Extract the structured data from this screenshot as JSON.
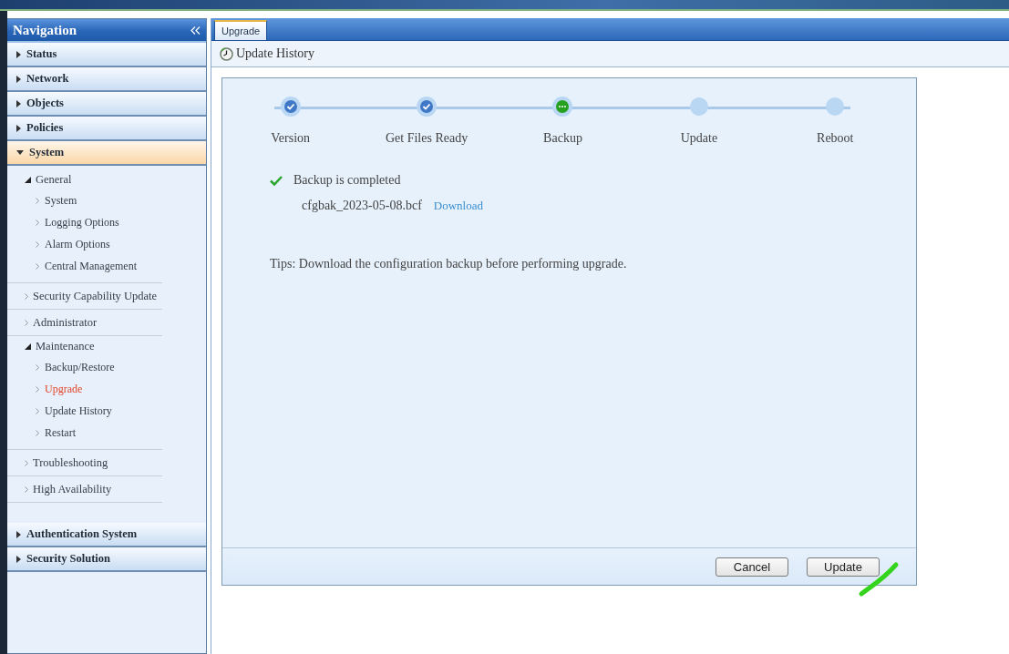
{
  "sidebar": {
    "title": "Navigation",
    "sections": [
      {
        "label": "Status",
        "expanded": false
      },
      {
        "label": "Network",
        "expanded": false
      },
      {
        "label": "Objects",
        "expanded": false
      },
      {
        "label": "Policies",
        "expanded": false
      },
      {
        "label": "System",
        "expanded": true,
        "children": [
          {
            "label": "General",
            "expanded": true,
            "children": [
              {
                "label": "System",
                "selected": false
              },
              {
                "label": "Logging Options",
                "selected": false
              },
              {
                "label": "Alarm Options",
                "selected": false
              },
              {
                "label": "Central Management",
                "selected": false
              }
            ]
          },
          {
            "label": "Security Capability Update",
            "expanded": false
          },
          {
            "label": "Administrator",
            "expanded": false
          },
          {
            "label": "Maintenance",
            "expanded": true,
            "children": [
              {
                "label": "Backup/Restore",
                "selected": false
              },
              {
                "label": "Upgrade",
                "selected": true
              },
              {
                "label": "Update History",
                "selected": false
              },
              {
                "label": "Restart",
                "selected": false
              }
            ]
          },
          {
            "label": "Troubleshooting",
            "expanded": false
          },
          {
            "label": "High Availability",
            "expanded": false
          }
        ]
      },
      {
        "label": "Authentication System",
        "expanded": false
      },
      {
        "label": "Security Solution",
        "expanded": false
      }
    ]
  },
  "tabs": [
    {
      "label": "Upgrade",
      "selected": true
    }
  ],
  "page_header": {
    "title": "Update History"
  },
  "wizard": {
    "steps": [
      {
        "label": "Version",
        "completed": true,
        "current": false
      },
      {
        "label": "Get Files Ready",
        "completed": true,
        "current": false
      },
      {
        "label": "Backup",
        "completed": false,
        "current": true
      },
      {
        "label": "Update",
        "completed": false,
        "current": false
      },
      {
        "label": "Reboot",
        "completed": false,
        "current": false
      }
    ],
    "message": "Backup is completed",
    "file_name": "cfgbak_2023-05-08.bcf",
    "download_link": "Download",
    "tips": "Tips: Download the configuration backup before performing upgrade.",
    "buttons": [
      "Cancel",
      "Update"
    ]
  }
}
